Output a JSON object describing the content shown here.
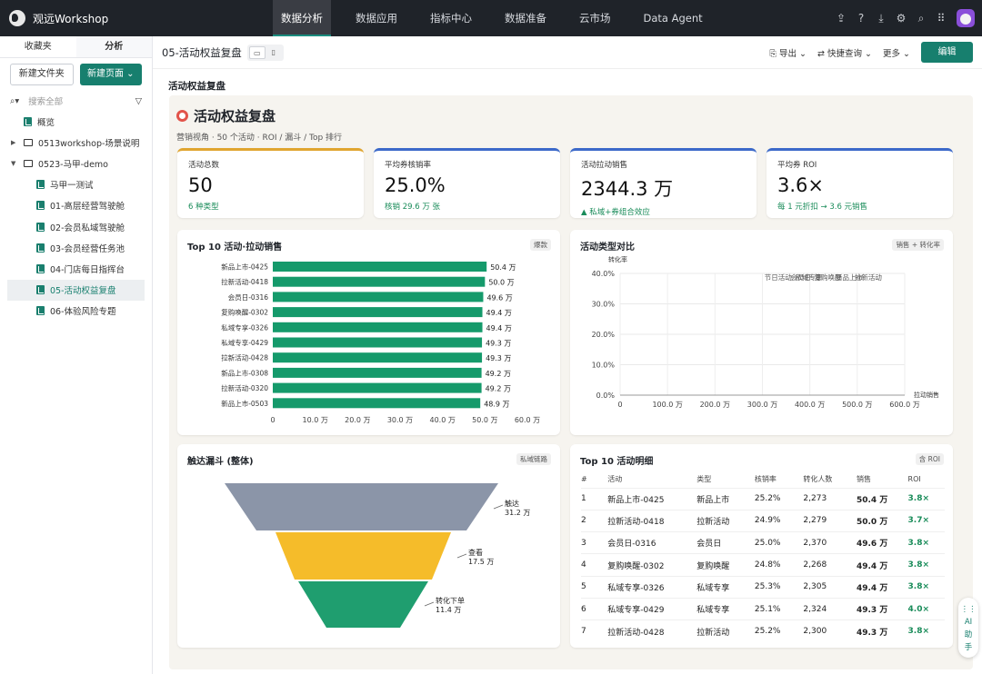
{
  "app": {
    "name": "观远Workshop"
  },
  "nav": [
    "数据分析",
    "数据应用",
    "指标中心",
    "数据准备",
    "云市场",
    "Data Agent"
  ],
  "sidebar": {
    "tabs": [
      "收藏夹",
      "分析"
    ],
    "new_folder": "新建文件夹",
    "new_page": "新建页面",
    "search_placeholder": "搜索全部",
    "items": [
      {
        "label": "概览",
        "type": "page"
      },
      {
        "label": "0513workshop-场景说明",
        "type": "folder"
      },
      {
        "label": "0523-马甲-demo",
        "type": "folder"
      },
      {
        "label": "马甲一测试",
        "type": "page"
      },
      {
        "label": "01-高层经营驾驶舱",
        "type": "page"
      },
      {
        "label": "02-会员私域驾驶舱",
        "type": "page"
      },
      {
        "label": "03-会员经营任务池",
        "type": "page"
      },
      {
        "label": "04-门店每日指挥台",
        "type": "page"
      },
      {
        "label": "05-活动权益复盘",
        "type": "page"
      },
      {
        "label": "06-体验风险专题",
        "type": "page"
      }
    ]
  },
  "main": {
    "page_title": "05-活动权益复盘",
    "tools": [
      "导出",
      "快捷查询",
      "更多"
    ],
    "edit": "编辑",
    "canvas_title": "活动权益复盘"
  },
  "report": {
    "title": "活动权益复盘",
    "subtitle": "营销视角 · 50 个活动 · ROI / 漏斗 / Top 排行",
    "kpis": [
      {
        "label": "活动总数",
        "value": "50",
        "note": "6 种类型"
      },
      {
        "label": "平均券核销率",
        "value": "25.0%",
        "note": "核销 29.6 万 张"
      },
      {
        "label": "活动拉动销售",
        "value": "2344.3 万",
        "note": "▲ 私域+券组合效应"
      },
      {
        "label": "平均券 ROI",
        "value": "3.6×",
        "note": "每 1 元折扣 → 3.6 元销售"
      }
    ]
  },
  "colors": {
    "accent": "#177f6e",
    "bar": "#159a6b",
    "funnel": [
      "#8b95a8",
      "#f5bc2a",
      "#1f9e6f"
    ]
  },
  "chart_data": [
    {
      "type": "bar",
      "title": "Top 10 活动·拉动销售",
      "tag": "爆款",
      "categories": [
        "新品上市-0425",
        "拉新活动-0418",
        "会员日-0316",
        "复购唤醒-0302",
        "私域专享-0326",
        "私域专享-0429",
        "拉新活动-0428",
        "新品上市-0308",
        "拉新活动-0320",
        "新品上市-0503"
      ],
      "values": [
        50.4,
        50.0,
        49.6,
        49.4,
        49.4,
        49.3,
        49.3,
        49.2,
        49.2,
        48.9
      ],
      "value_labels": [
        "50.4 万",
        "50.0 万",
        "49.6 万",
        "49.4 万",
        "49.4 万",
        "49.3 万",
        "49.3 万",
        "49.2 万",
        "49.2 万",
        "48.9 万"
      ],
      "xticks": [
        "0",
        "10.0 万",
        "20.0 万",
        "30.0 万",
        "40.0 万",
        "50.0 万",
        "60.0 万"
      ],
      "xlim": [
        0,
        60
      ]
    },
    {
      "type": "scatter",
      "title": "活动类型对比",
      "tag": "销售 + 转化率",
      "ylabel": "转化率",
      "xlabel": "拉动销售",
      "yticks": [
        "0.0%",
        "10.0%",
        "20.0%",
        "30.0%",
        "40.0%"
      ],
      "xticks": [
        "0",
        "100.0 万",
        "200.0 万",
        "300.0 万",
        "400.0 万",
        "500.0 万",
        "600.0 万"
      ],
      "points": [
        {
          "label": "节日活动",
          "x": 310
        },
        {
          "label": "会员日",
          "x": 365
        },
        {
          "label": "私域专享",
          "x": 375
        },
        {
          "label": "复购唤醒",
          "x": 415
        },
        {
          "label": "新品上市",
          "x": 460
        },
        {
          "label": "拉新活动",
          "x": 500
        }
      ]
    },
    {
      "type": "funnel",
      "title": "触达漏斗 (整体)",
      "tag": "私域链路",
      "stages": [
        {
          "name": "触达",
          "value": 31.2,
          "label": "31.2 万"
        },
        {
          "name": "查看",
          "value": 17.5,
          "label": "17.5 万"
        },
        {
          "name": "转化下单",
          "value": 11.4,
          "label": "11.4 万"
        }
      ]
    },
    {
      "type": "table",
      "title": "Top 10 活动明细",
      "tag": "含 ROI",
      "columns": [
        "#",
        "活动",
        "类型",
        "核销率",
        "转化人数",
        "销售",
        "ROI"
      ],
      "rows": [
        [
          "1",
          "新品上市-0425",
          "新品上市",
          "25.2%",
          "2,273",
          "50.4 万",
          "3.8×"
        ],
        [
          "2",
          "拉新活动-0418",
          "拉新活动",
          "24.9%",
          "2,279",
          "50.0 万",
          "3.7×"
        ],
        [
          "3",
          "会员日-0316",
          "会员日",
          "25.0%",
          "2,370",
          "49.6 万",
          "3.8×"
        ],
        [
          "4",
          "复购唤醒-0302",
          "复购唤醒",
          "24.8%",
          "2,268",
          "49.4 万",
          "3.8×"
        ],
        [
          "5",
          "私域专享-0326",
          "私域专享",
          "25.3%",
          "2,305",
          "49.4 万",
          "3.8×"
        ],
        [
          "6",
          "私域专享-0429",
          "私域专享",
          "25.1%",
          "2,324",
          "49.3 万",
          "4.0×"
        ],
        [
          "7",
          "拉新活动-0428",
          "拉新活动",
          "25.2%",
          "2,300",
          "49.3 万",
          "3.8×"
        ]
      ]
    }
  ],
  "ai_help": "AI 助手"
}
